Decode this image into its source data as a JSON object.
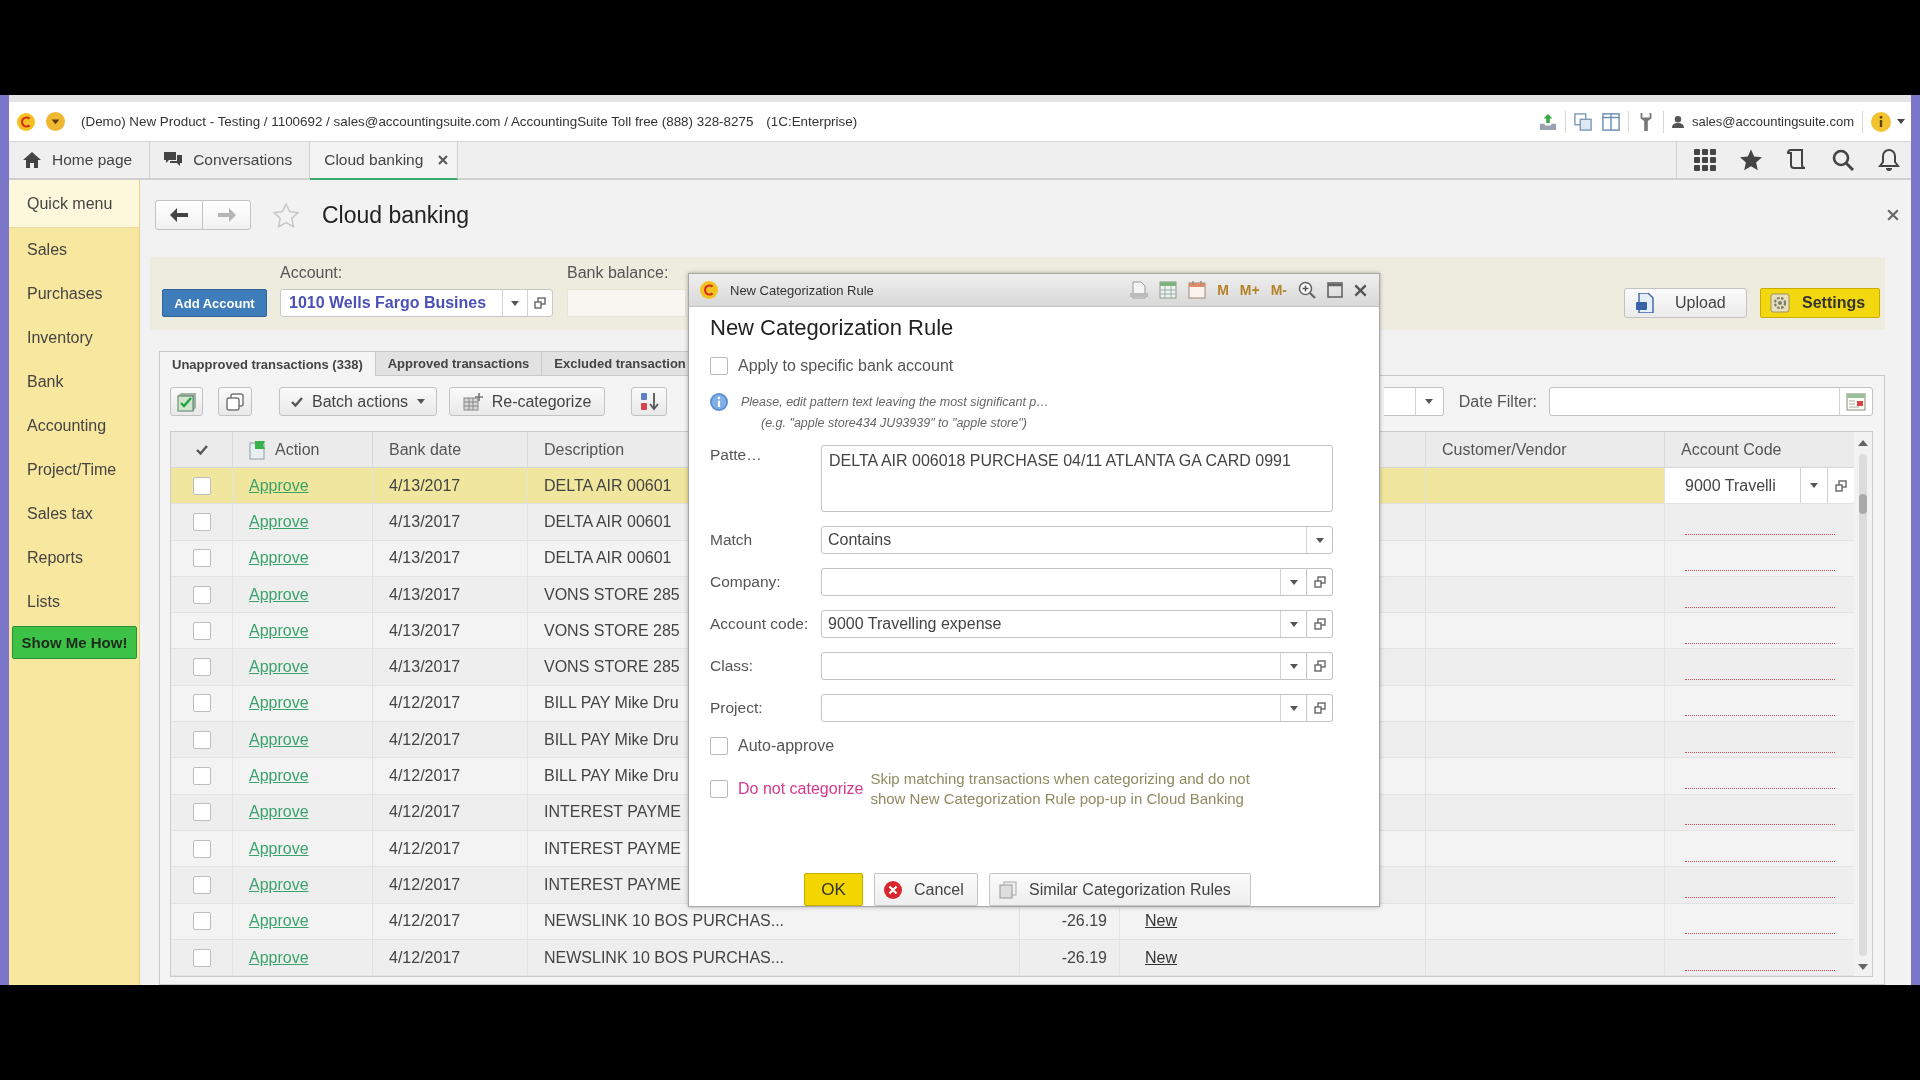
{
  "title_bar": {
    "title": "(Demo) New Product - Testing / 1100692 / sales@accountingsuite.com / AccountingSuite Toll free (888) 328-8275",
    "platform": "(1C:Enterprise)",
    "user": "sales@accountingsuite.com"
  },
  "tabs": [
    {
      "label": "Home page",
      "selected": false
    },
    {
      "label": "Conversations",
      "selected": false
    },
    {
      "label": "Cloud banking",
      "selected": true
    }
  ],
  "sidebar": {
    "header": "Quick menu",
    "items": [
      "Sales",
      "Purchases",
      "Inventory",
      "Bank",
      "Accounting",
      "Project/Time",
      "Sales tax",
      "Reports",
      "Lists"
    ],
    "help_button": "Show Me How!"
  },
  "page": {
    "title": "Cloud banking",
    "favorite": false,
    "back_disabled": false,
    "forward_disabled": true
  },
  "account_panel": {
    "add_button": "Add Account",
    "account_label": "Account:",
    "account_value": "1010 Wells Fargo Busines",
    "balance_label": "Bank balance:",
    "upload_button": "Upload",
    "settings_button": "Settings"
  },
  "transaction_tabs": [
    {
      "label": "Unapproved transactions (338)",
      "selected": true
    },
    {
      "label": "Approved transactions",
      "selected": false
    },
    {
      "label": "Excluded transaction",
      "selected": false
    }
  ],
  "toolbar": {
    "batch_button": "Batch actions",
    "recategorize_button": "Re-categorize",
    "date_filter_label": "Date Filter:"
  },
  "table": {
    "columns": [
      "Action",
      "Bank date",
      "Description",
      "Customer/Vendor",
      "Account Code"
    ],
    "rows": [
      {
        "selected": true,
        "checked": false,
        "action": "Approve",
        "date": "4/13/2017",
        "description": "DELTA AIR 00601",
        "account_code": "9000 Travelli"
      },
      {
        "selected": false,
        "checked": false,
        "action": "Approve",
        "date": "4/13/2017",
        "description": "DELTA AIR 00601"
      },
      {
        "selected": false,
        "checked": false,
        "action": "Approve",
        "date": "4/13/2017",
        "description": "DELTA AIR 00601"
      },
      {
        "selected": false,
        "checked": false,
        "action": "Approve",
        "date": "4/13/2017",
        "description": "VONS STORE 285"
      },
      {
        "selected": false,
        "checked": false,
        "action": "Approve",
        "date": "4/13/2017",
        "description": "VONS STORE 285"
      },
      {
        "selected": false,
        "checked": false,
        "action": "Approve",
        "date": "4/13/2017",
        "description": "VONS STORE 285"
      },
      {
        "selected": false,
        "checked": false,
        "action": "Approve",
        "date": "4/12/2017",
        "description": "BILL PAY Mike Dru"
      },
      {
        "selected": false,
        "checked": false,
        "action": "Approve",
        "date": "4/12/2017",
        "description": "BILL PAY Mike Dru"
      },
      {
        "selected": false,
        "checked": false,
        "action": "Approve",
        "date": "4/12/2017",
        "description": "BILL PAY Mike Dru"
      },
      {
        "selected": false,
        "checked": false,
        "action": "Approve",
        "date": "4/12/2017",
        "description": "INTEREST PAYME"
      },
      {
        "selected": false,
        "checked": false,
        "action": "Approve",
        "date": "4/12/2017",
        "description": "INTEREST PAYME"
      },
      {
        "selected": false,
        "checked": false,
        "action": "Approve",
        "date": "4/12/2017",
        "description": "INTEREST PAYME"
      },
      {
        "selected": false,
        "checked": false,
        "action": "Approve",
        "date": "4/12/2017",
        "description": "NEWSLINK 10 BOS PURCHAS...",
        "amount": "-26.19",
        "status": "New"
      },
      {
        "selected": false,
        "checked": false,
        "action": "Approve",
        "date": "4/12/2017",
        "description": "NEWSLINK 10 BOS PURCHAS...",
        "amount": "-26.19",
        "status": "New"
      }
    ]
  },
  "dialog": {
    "title": "New Categorization Rule",
    "memory_buttons": [
      "M",
      "M+",
      "M-"
    ],
    "heading": "New Categorization Rule",
    "apply_specific": {
      "label": "Apply to specific bank account",
      "checked": false
    },
    "info": "Please, edit pattern text leaving the most significant p…",
    "example": "(e.g. \"apple store434 JU93939\" to \"apple store\")",
    "fields": [
      {
        "kind": "textarea",
        "label": "Patte…",
        "value": "DELTA AIR 006018 PURCHASE 04/11 ATLANTA GA CARD 0991"
      },
      {
        "kind": "select",
        "label": "Match",
        "value": "Contains"
      },
      {
        "kind": "lookup",
        "label": "Company:"
      },
      {
        "kind": "lookup",
        "label": "Account code:",
        "value": "9000 Travelling expense"
      },
      {
        "kind": "lookup",
        "label": "Class:"
      },
      {
        "kind": "lookup",
        "label": "Project:"
      }
    ],
    "auto_approve": {
      "label": "Auto-approve",
      "checked": false
    },
    "do_not_categorize": {
      "label": "Do not categorize",
      "checked": false,
      "hint": "Skip matching transactions when categorizing and do not show New Categorization Rule pop-up in Cloud Banking"
    },
    "buttons": {
      "ok": "OK",
      "cancel": "Cancel",
      "similar": "Similar Categorization Rules"
    }
  }
}
